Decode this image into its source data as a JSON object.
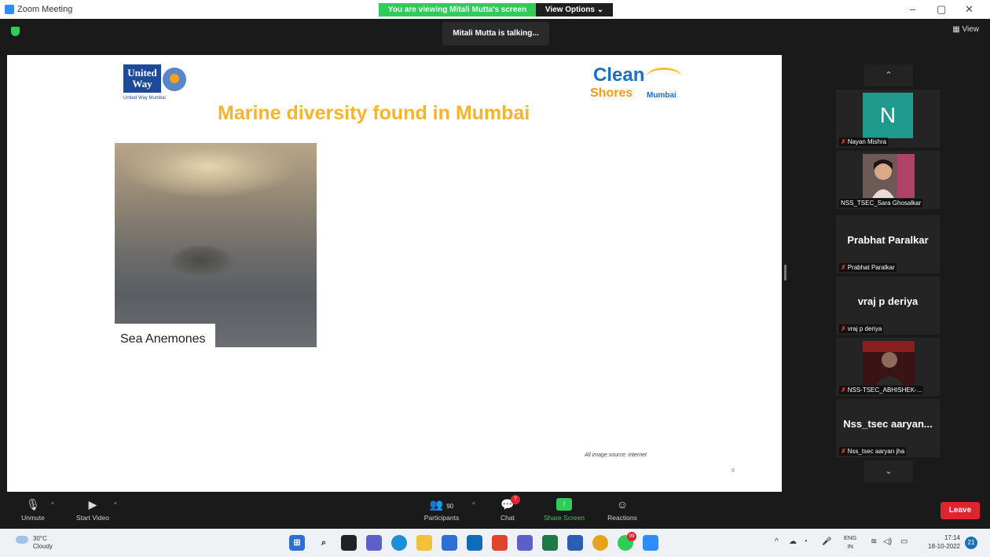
{
  "window": {
    "title": "Zoom Meeting",
    "viewing_banner": "You are viewing Mitali Mutta's screen",
    "view_options": "View Options ⌄",
    "talking": "Mitali Mutta is talking...",
    "view_button": "View",
    "minimize": "–",
    "maximize": "▢",
    "close": "✕"
  },
  "slide": {
    "uw_logo": {
      "text": "United Way",
      "caption": "United Way Mumbai"
    },
    "title": "Marine diversity found in Mumbai",
    "cs_logo": {
      "clean": "Clean",
      "shores": "Shores",
      "mumbai": "Mumbai"
    },
    "image_caption": "Sea Anemones",
    "source": "All image source: internet",
    "page_number": "8"
  },
  "gallery": {
    "up_arrow": "⌃",
    "down_arrow": "⌄",
    "tiles": [
      {
        "type": "avatar",
        "avatar_letter": "N",
        "name": "Nayan Mishra",
        "muted": true
      },
      {
        "type": "video",
        "name": "NSS_TSEC_Sara Ghosalkar",
        "muted": false
      },
      {
        "type": "name",
        "big_name": "Prabhat Paralkar",
        "name": "Prabhat Paralkar",
        "muted": true
      },
      {
        "type": "name",
        "big_name": "vraj p deriya",
        "name": "vraj p deriya",
        "muted": true
      },
      {
        "type": "video",
        "name": "NSS-TSEC_ABHISHEK-...",
        "muted": true
      },
      {
        "type": "name",
        "big_name": "Nss_tsec aaryan...",
        "name": "Nss_tsec aaryan jha",
        "muted": true
      }
    ]
  },
  "controls": {
    "unmute": "Unmute",
    "start_video": "Start Video",
    "participants": "Participants",
    "participants_count": "90",
    "chat": "Chat",
    "chat_badge": "7",
    "share_screen": "Share Screen",
    "reactions": "Reactions",
    "leave": "Leave"
  },
  "taskbar": {
    "temperature": "30°C",
    "weather": "Cloudy",
    "language": "ENG",
    "region": "IN",
    "time": "17:14",
    "date": "18-10-2022",
    "notifications": "21",
    "chrome_badge": "99",
    "apps": [
      "windows-start",
      "search",
      "task-view",
      "chat",
      "edge",
      "file-explorer",
      "store",
      "outlook",
      "office",
      "teams",
      "excel",
      "word",
      "chrome",
      "whatsapp",
      "zoom"
    ]
  }
}
